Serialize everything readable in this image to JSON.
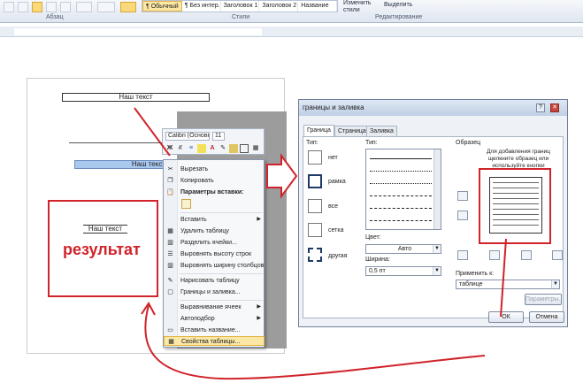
{
  "ribbon": {
    "group_paragraph": "Абзац",
    "group_styles": "Стили",
    "group_editing": "Редактирование",
    "styles": [
      "¶ Обычный",
      "¶ Без интер...",
      "Заголовок 1",
      "Заголовок 2",
      "Название"
    ],
    "change_styles": "Изменить стили",
    "select": "Выделить"
  },
  "document": {
    "top_text": "Наш текст",
    "blue_cell_text": "Наш текст",
    "result_text": "Наш текст",
    "result_label": "результат"
  },
  "mini_toolbar": {
    "font": "Calibri (Основн",
    "size": "11",
    "bold": "Ж",
    "italic": "К"
  },
  "context_menu": {
    "items": [
      {
        "label": "Вырезать",
        "icon": "scissors-icon"
      },
      {
        "label": "Копировать",
        "icon": "copy-icon"
      },
      {
        "label": "Параметры вставки:",
        "icon": "paste-icon"
      },
      {
        "label": "Вставить",
        "icon": ""
      },
      {
        "label": "Удалить таблицу",
        "icon": "delete-table-icon"
      },
      {
        "label": "Разделить ячейки...",
        "icon": "split-cells-icon"
      },
      {
        "label": "Выровнять высоту строк",
        "icon": "row-height-icon"
      },
      {
        "label": "Выровнять ширину столбцов",
        "icon": "column-width-icon"
      },
      {
        "label": "Нарисовать таблицу",
        "icon": "pencil-icon"
      },
      {
        "label": "Границы и заливка...",
        "icon": "borders-icon"
      },
      {
        "label": "Выравнивание ячеек",
        "icon": ""
      },
      {
        "label": "Автоподбор",
        "icon": ""
      },
      {
        "label": "Вставить название...",
        "icon": "caption-icon"
      },
      {
        "label": "Свойства таблицы...",
        "icon": "table-properties-icon"
      }
    ]
  },
  "dialog": {
    "title": "границы и заливка",
    "tabs": [
      "Граница",
      "Страница",
      "Заливка"
    ],
    "type_label": "Тип:",
    "types": [
      "нет",
      "рамка",
      "все",
      "сетка",
      "другая"
    ],
    "style_label": "Тип:",
    "color_label": "Цвет:",
    "color_value": "Авто",
    "width_label": "Ширина:",
    "width_value": "0,5 пт",
    "sample_label": "Образец",
    "sample_hint": "Для добавления границ щелкните образец или используйте кнопки",
    "apply_label": "Применить к:",
    "apply_value": "таблице",
    "options_button": "Параметры...",
    "ok_button": "ОК",
    "cancel_button": "Отмена",
    "help_glyph": "?",
    "close_glyph": "✕"
  },
  "colors": {
    "accent_red": "#d0232a",
    "highlight": "#fbe8a6",
    "table_blue": "#a9c8ee"
  }
}
